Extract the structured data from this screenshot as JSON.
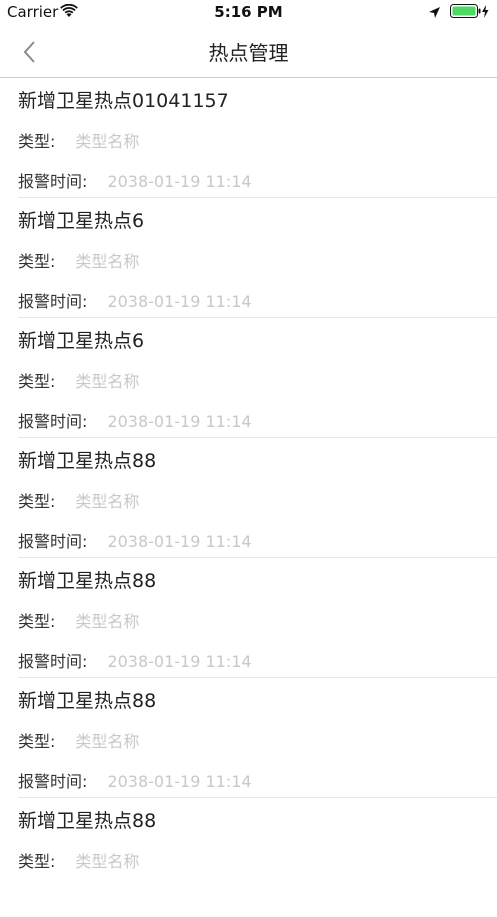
{
  "status_bar": {
    "carrier": "Carrier",
    "time": "5:16 PM"
  },
  "nav": {
    "title": "热点管理",
    "back_icon": "chevron-left-icon"
  },
  "list": {
    "type_label": "类型:",
    "time_label": "报警时间:",
    "items": [
      {
        "title": "新增卫星热点01041157",
        "type": "类型名称",
        "time": "2038-01-19 11:14"
      },
      {
        "title": "新增卫星热点6",
        "type": "类型名称",
        "time": "2038-01-19 11:14"
      },
      {
        "title": "新增卫星热点6",
        "type": "类型名称",
        "time": "2038-01-19 11:14"
      },
      {
        "title": "新增卫星热点88",
        "type": "类型名称",
        "time": "2038-01-19 11:14"
      },
      {
        "title": "新增卫星热点88",
        "type": "类型名称",
        "time": "2038-01-19 11:14"
      },
      {
        "title": "新增卫星热点88",
        "type": "类型名称",
        "time": "2038-01-19 11:14"
      },
      {
        "title": "新增卫星热点88",
        "type": "类型名称",
        "time": ""
      }
    ]
  },
  "colors": {
    "accent_battery": "#4cd964",
    "muted_value": "#c8c8c8"
  }
}
